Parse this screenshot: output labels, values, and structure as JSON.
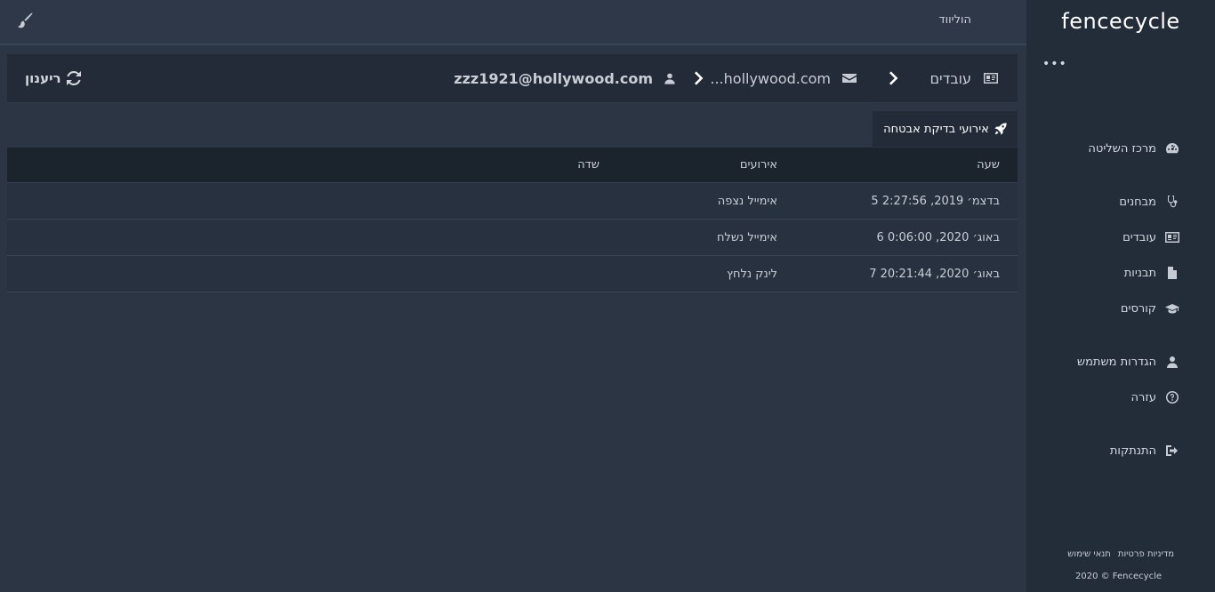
{
  "sidebar": {
    "logo": "fencecycle",
    "menu_dots": "•••",
    "items": [
      {
        "label": "מרכז השליטה",
        "icon": "dashboard-icon"
      },
      {
        "label": "מבחנים",
        "icon": "stethoscope-icon"
      },
      {
        "label": "עובדים",
        "icon": "id-card-icon"
      },
      {
        "label": "תבניות",
        "icon": "file-icon"
      },
      {
        "label": "קורסים",
        "icon": "graduation-cap-icon"
      },
      {
        "label": "הגדרות משתמש",
        "icon": "user-icon"
      },
      {
        "label": "עזרה",
        "icon": "question-circle-icon"
      },
      {
        "label": "התנתקות",
        "icon": "sign-out-icon"
      }
    ],
    "footer": {
      "privacy": "מדיניות פרטיות",
      "terms": "תנאי שימוש",
      "copyright": "2020 © Fencecycle"
    }
  },
  "topbar": {
    "org_name": "הוליווד",
    "theme_icon": "paint-brush-icon"
  },
  "breadcrumb": {
    "employees": "עובדים",
    "domain": "...hollywood.com",
    "email": "zzz1921@hollywood.com",
    "refresh": "ריענון"
  },
  "tab": {
    "label": "אירועי בדיקת אבטחה",
    "icon": "rocket-icon"
  },
  "table": {
    "headers": {
      "time": "שעה",
      "event": "אירועים",
      "field": "שדה"
    },
    "rows": [
      {
        "time": "5 בדצמ׳ 2019, 2:27:56",
        "event": "אימייל נצפה",
        "field": ""
      },
      {
        "time": "6 באוג׳ 2020, 0:06:00",
        "event": "אימייל נשלח",
        "field": ""
      },
      {
        "time": "7 באוג׳ 2020, 20:21:44",
        "event": "לינק נלחץ",
        "field": ""
      }
    ]
  },
  "colors": {
    "background": "#2b3544",
    "sidebar": "#232d3a",
    "panel": "#222b37",
    "table_header": "#1b232d"
  }
}
